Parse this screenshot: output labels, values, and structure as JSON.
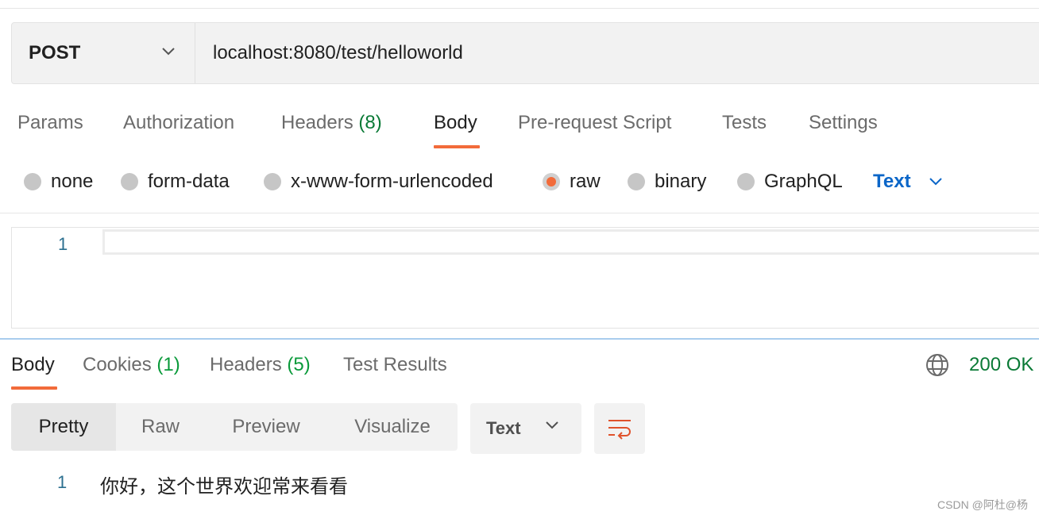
{
  "request": {
    "method": "POST",
    "url": "localhost:8080/test/helloworld"
  },
  "request_tabs": [
    {
      "label": "Params",
      "count": ""
    },
    {
      "label": "Authorization",
      "count": ""
    },
    {
      "label": "Headers",
      "count": "(8)"
    },
    {
      "label": "Body",
      "count": "",
      "active": true
    },
    {
      "label": "Pre-request Script",
      "count": ""
    },
    {
      "label": "Tests",
      "count": ""
    },
    {
      "label": "Settings",
      "count": ""
    }
  ],
  "body_types": [
    {
      "label": "none",
      "selected": false
    },
    {
      "label": "form-data",
      "selected": false
    },
    {
      "label": "x-www-form-urlencoded",
      "selected": false
    },
    {
      "label": "raw",
      "selected": true
    },
    {
      "label": "binary",
      "selected": false
    },
    {
      "label": "GraphQL",
      "selected": false
    }
  ],
  "raw_format": "Text",
  "editor": {
    "line_number": "1",
    "content": ""
  },
  "response_tabs": [
    {
      "label": "Body",
      "count": "",
      "active": true
    },
    {
      "label": "Cookies",
      "count": "(1)"
    },
    {
      "label": "Headers",
      "count": "(5)"
    },
    {
      "label": "Test Results",
      "count": ""
    }
  ],
  "status": "200 OK",
  "view_modes": [
    {
      "label": "Pretty",
      "active": true
    },
    {
      "label": "Raw"
    },
    {
      "label": "Preview"
    },
    {
      "label": "Visualize"
    }
  ],
  "response_format": "Text",
  "response_body": {
    "line_number": "1",
    "text": "你好，这个世界欢迎常来看看"
  },
  "watermark": "CSDN @阿杜@杨",
  "colors": {
    "accent": "#f26b3a",
    "link_blue": "#0b66c8",
    "success_green": "#0a7a36",
    "line_number": "#2b6f8f"
  },
  "icons": {
    "method_dropdown": "chevron-down-icon",
    "format_dropdown": "chevron-down-icon",
    "network": "globe-icon",
    "wrap": "word-wrap-icon"
  }
}
